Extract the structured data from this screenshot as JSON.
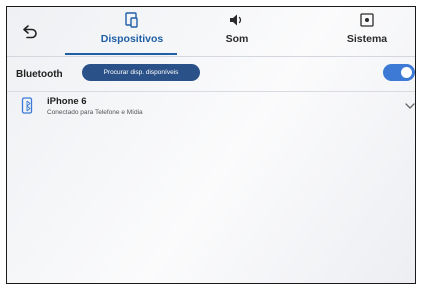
{
  "header": {
    "tabs": [
      {
        "label": "Dispositivos",
        "icon": "phone-screen-icon",
        "active": true
      },
      {
        "label": "Som",
        "icon": "speaker-icon",
        "active": false
      },
      {
        "label": "Sistema",
        "icon": "system-settings-icon",
        "active": false
      }
    ]
  },
  "bluetooth": {
    "label": "Bluetooth",
    "search_button": "Procurar disp. disponíveis",
    "enabled": true
  },
  "devices": [
    {
      "name": "iPhone 6",
      "status": "Conectado para Telefone e Mídia"
    }
  ],
  "colors": {
    "accent": "#1f5fa6",
    "button_bg": "#2b5288",
    "toggle_on": "#3d7ad6"
  }
}
